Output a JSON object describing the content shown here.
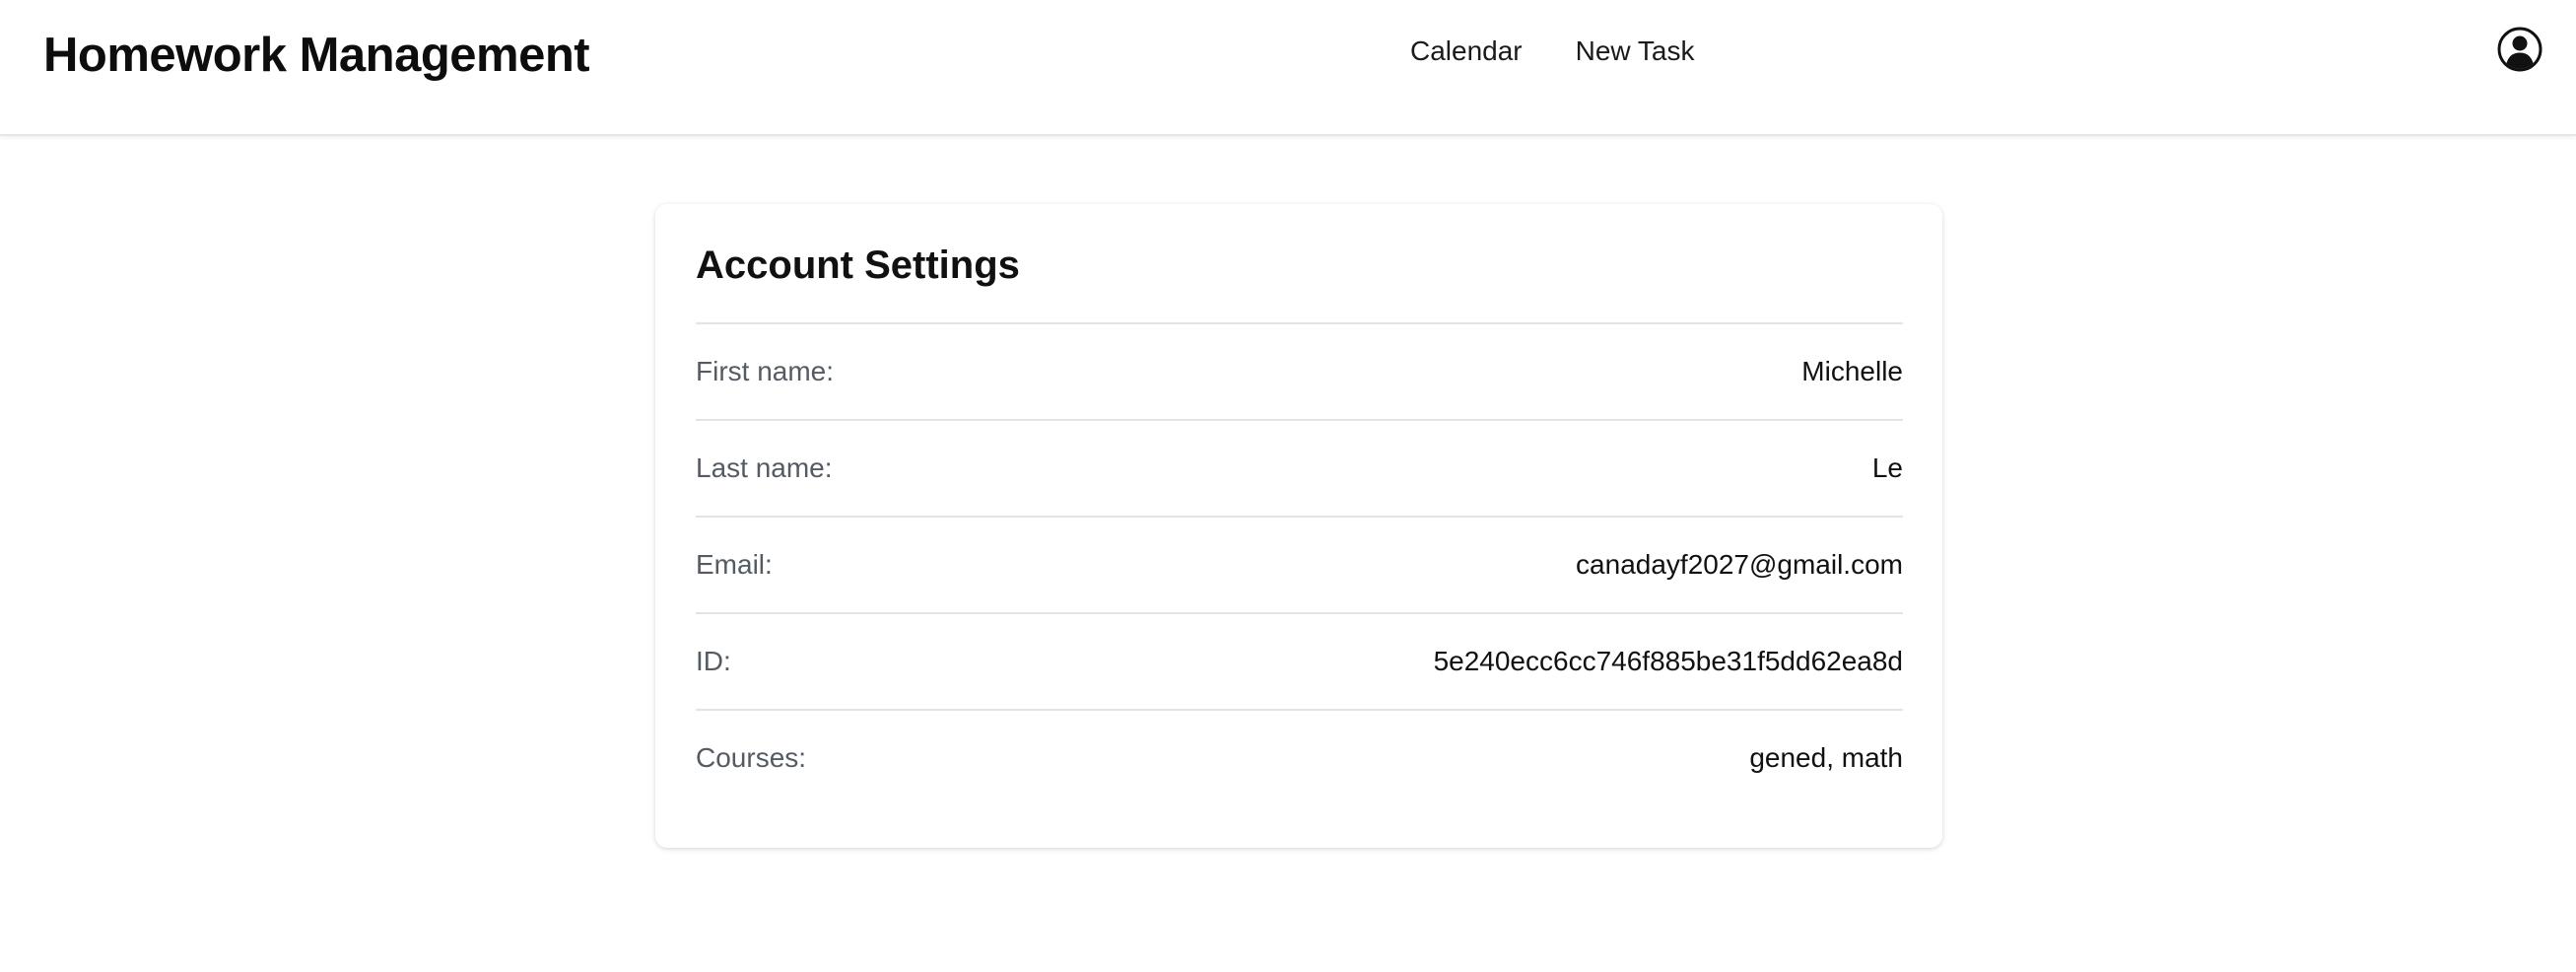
{
  "header": {
    "title": "Homework Management",
    "nav": [
      {
        "label": "Calendar"
      },
      {
        "label": "New Task"
      }
    ],
    "avatar_icon": "user-circle-icon"
  },
  "account": {
    "title": "Account Settings",
    "fields": [
      {
        "label": "First name:",
        "value": "Michelle"
      },
      {
        "label": "Last name:",
        "value": "Le"
      },
      {
        "label": "Email:",
        "value": "canadayf2027@gmail.com"
      },
      {
        "label": "ID:",
        "value": "5e240ecc6cc746f885be31f5dd62ea8d"
      },
      {
        "label": "Courses:",
        "value": "gened, math"
      }
    ]
  },
  "colors": {
    "text": "#111111",
    "label": "#555b63",
    "divider": "#e4e4e4",
    "background": "#ffffff"
  }
}
